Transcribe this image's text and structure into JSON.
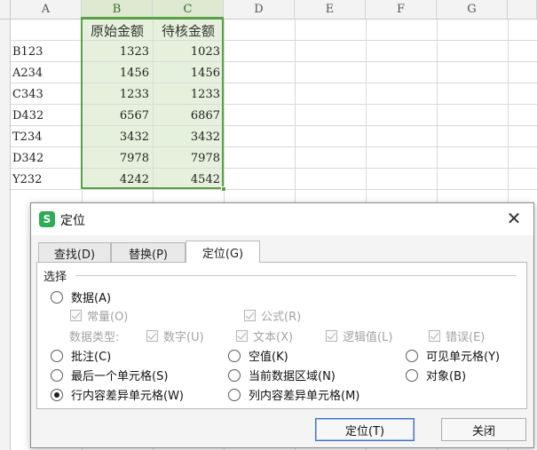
{
  "sheet": {
    "columns": [
      "A",
      "B",
      "C",
      "D",
      "E",
      "F",
      "G"
    ],
    "header_row": {
      "b": "原始金额",
      "c": "待核金额"
    },
    "rows": [
      {
        "id": "B123",
        "b": "1323",
        "c": "1023"
      },
      {
        "id": "A234",
        "b": "1456",
        "c": "1456"
      },
      {
        "id": "C343",
        "b": "1233",
        "c": "1233"
      },
      {
        "id": "D432",
        "b": "6567",
        "c": "6867"
      },
      {
        "id": "T234",
        "b": "3432",
        "c": "3432"
      },
      {
        "id": "D342",
        "b": "7978",
        "c": "7978"
      },
      {
        "id": "Y232",
        "b": "4242",
        "c": "4542"
      }
    ],
    "selection_color": "#5aa046"
  },
  "dialog": {
    "title": "定位",
    "app_icon_letter": "S",
    "close_glyph": "✕",
    "tabs": [
      {
        "label": "查找(D)",
        "active": false
      },
      {
        "label": "替换(P)",
        "active": false
      },
      {
        "label": "定位(G)",
        "active": true
      }
    ],
    "section_label": "选择",
    "options": {
      "data": "数据(A)",
      "constant": "常量(O)",
      "formula": "公式(R)",
      "data_type_label": "数据类型:",
      "number": "数字(U)",
      "text": "文本(X)",
      "logical": "逻辑值(L)",
      "error": "错误(E)",
      "comment": "批注(C)",
      "blank": "空值(K)",
      "visible_cells": "可见单元格(Y)",
      "last_cell": "最后一个单元格(S)",
      "current_region": "当前数据区域(N)",
      "objects": "对象(B)",
      "row_diff": "行内容差异单元格(W)",
      "col_diff": "列内容差异单元格(M)"
    },
    "selected_option": "row_diff",
    "buttons": {
      "locate": "定位(T)",
      "close": "关闭"
    }
  }
}
